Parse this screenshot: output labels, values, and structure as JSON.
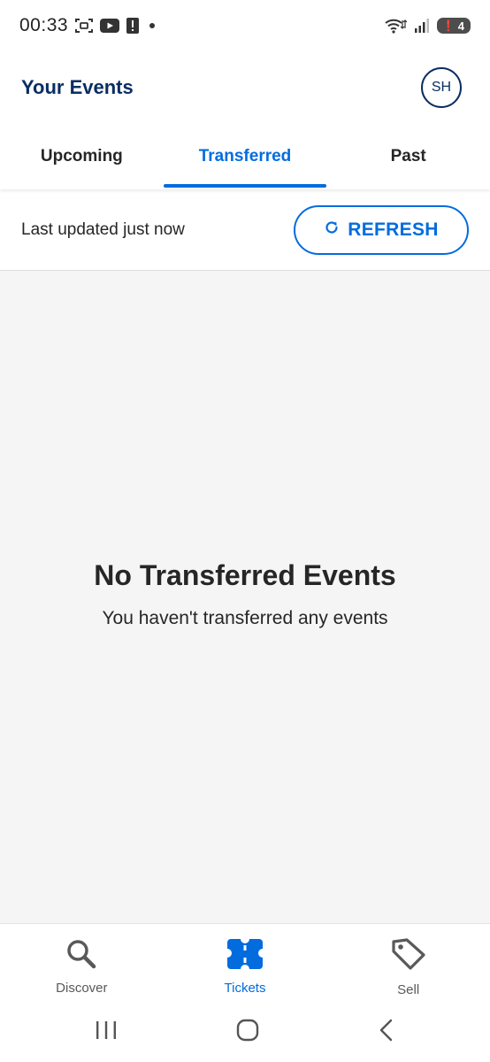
{
  "status_bar": {
    "time": "00:33",
    "battery_level": "4"
  },
  "header": {
    "title": "Your Events",
    "avatar_initials": "SH"
  },
  "tabs": [
    {
      "label": "Upcoming",
      "active": false
    },
    {
      "label": "Transferred",
      "active": true
    },
    {
      "label": "Past",
      "active": false
    }
  ],
  "update_bar": {
    "last_updated": "Last updated just now",
    "refresh_label": "REFRESH"
  },
  "empty_state": {
    "title": "No Transferred Events",
    "subtitle": "You haven't transferred any events"
  },
  "bottom_nav": [
    {
      "label": "Discover",
      "icon": "search-icon",
      "active": false
    },
    {
      "label": "Tickets",
      "icon": "ticket-icon",
      "active": true
    },
    {
      "label": "Sell",
      "icon": "tag-icon",
      "active": false
    }
  ],
  "colors": {
    "accent": "#026cdf",
    "title_navy": "#0a2e63",
    "background_grey": "#f5f5f5"
  }
}
